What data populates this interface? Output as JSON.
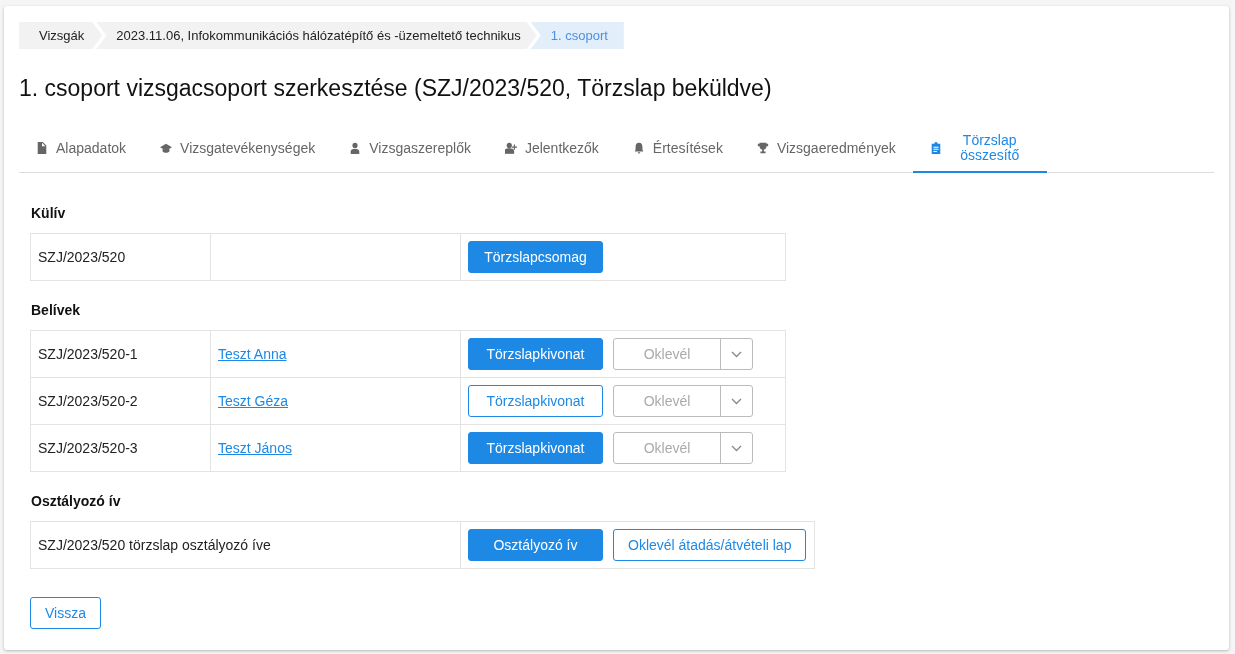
{
  "breadcrumb": [
    {
      "label": "Vizsgák",
      "selected": false
    },
    {
      "label": "2023.11.06, Infokommunikációs hálózatépítő és -üzemeltető technikus",
      "selected": false
    },
    {
      "label": "1. csoport",
      "selected": true
    }
  ],
  "title": "1. csoport vizsgacsoport szerkesztése (SZJ/2023/520, Törzslap beküldve)",
  "tabs": [
    {
      "label": "Alapadatok",
      "selected": false
    },
    {
      "label": "Vizsgatevékenységek",
      "selected": false
    },
    {
      "label": "Vizsgaszereplők",
      "selected": false
    },
    {
      "label": "Jelentkezők",
      "selected": false
    },
    {
      "label": "Értesítések",
      "selected": false
    },
    {
      "label": "Vizsgaeredmények",
      "selected": false
    },
    {
      "label": "Törzslap összesítő",
      "selected": true
    }
  ],
  "kuliv": {
    "heading": "Külív",
    "rows": [
      {
        "code": "SZJ/2023/520",
        "button": {
          "label": "Törzslapcsomag",
          "kind": "primary"
        }
      }
    ]
  },
  "belivek": {
    "heading": "Belívek",
    "rows": [
      {
        "code": "SZJ/2023/520-1",
        "name": "Teszt Anna",
        "button": {
          "label": "Törzslapkivonat",
          "kind": "primary"
        },
        "oklevel": {
          "label": "Oklevél",
          "disabled": true
        }
      },
      {
        "code": "SZJ/2023/520-2",
        "name": "Teszt Géza",
        "button": {
          "label": "Törzslapkivonat",
          "kind": "outline"
        },
        "oklevel": {
          "label": "Oklevél",
          "disabled": true
        }
      },
      {
        "code": "SZJ/2023/520-3",
        "name": "Teszt János",
        "button": {
          "label": "Törzslapkivonat",
          "kind": "primary"
        },
        "oklevel": {
          "label": "Oklevél",
          "disabled": true
        }
      }
    ]
  },
  "osztalyozo": {
    "heading": "Osztályozó ív",
    "rows": [
      {
        "text": "SZJ/2023/520 törzslap osztályozó íve",
        "buttons": [
          {
            "label": "Osztályozó ív",
            "kind": "primary"
          },
          {
            "label": "Oklevél átadás/átvételi lap",
            "kind": "outline"
          }
        ]
      }
    ]
  },
  "back_button": "Vissza"
}
